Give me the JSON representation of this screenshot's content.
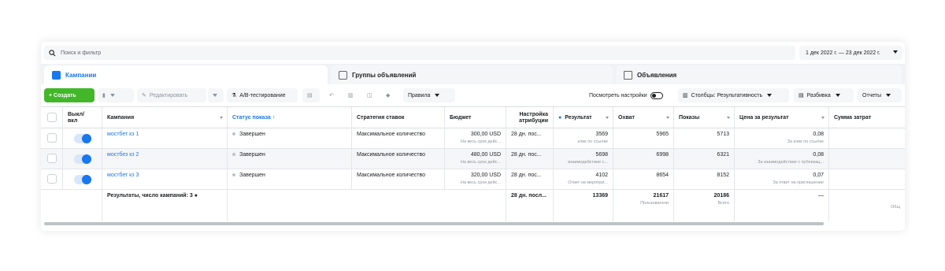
{
  "search": {
    "placeholder": "Поиск и фильтр"
  },
  "date_range": "1 дек 2022 г. — 23 дек 2022 г.",
  "tabs": [
    {
      "label": "Кампании"
    },
    {
      "label": "Группы объявлений"
    },
    {
      "label": "Объявления"
    }
  ],
  "toolbar": {
    "create": "+ Создать",
    "edit": "Редактировать",
    "ab_test": "A/B-тестирование",
    "rules": "Правила",
    "view_settings": "Посмотреть настройки",
    "columns": "Столбцы: Результативность",
    "breakdown": "Разбивка",
    "reports": "Отчеты"
  },
  "columns": {
    "onoff": "Выкл/ вкл",
    "campaign": "Кампания",
    "status": "Статус показа ↑",
    "bid": "Стратегия ставок",
    "budget": "Бюджет",
    "attribution": "Настройка атрибуции",
    "result": "Результат",
    "reach": "Охват",
    "impressions": "Показы",
    "cost_per_result": "Цена за результат",
    "spend": "Сумма затрат"
  },
  "rows": [
    {
      "name": "мостбет кз 1",
      "status": "Завершен",
      "bid": "Максимальное количество",
      "budget": "300,00 USD",
      "budget_sub": "На весь срок дейс...",
      "attribution": "28 дн. пос...",
      "result": "3569",
      "result_sub": "клик по ссылке",
      "reach": "5965",
      "impressions": "5713",
      "cost": "0,08",
      "cost_sub": "За клик по ссылке"
    },
    {
      "name": "мостбез кз 2",
      "status": "Завершен",
      "bid": "Максимальное количество",
      "budget": "480,00 USD",
      "budget_sub": "На весь срок дейс...",
      "attribution": "28 дн. пос...",
      "result": "5698",
      "result_sub": "взаимодействие с...",
      "reach": "6998",
      "impressions": "6321",
      "cost": "0,08",
      "cost_sub": "За взаимодействие с публикац..."
    },
    {
      "name": "мостбет кз 3",
      "status": "Завершен",
      "bid": "Максимальное количество",
      "budget": "320,00 USD",
      "budget_sub": "На весь срок дейс...",
      "attribution": "28 дн. пос...",
      "result": "4102",
      "result_sub": "Ответ на меропри...",
      "reach": "8654",
      "impressions": "8152",
      "cost": "0,07",
      "cost_sub": "За ответ на приглашение"
    }
  ],
  "totals": {
    "label": "Результаты, число кампаний: 3",
    "attribution": "28 дн. посл...",
    "result": "13369",
    "reach": "21617",
    "reach_sub": "Пользователи",
    "impressions": "20186",
    "impressions_sub": "Всего",
    "cost": "—",
    "spend_sub": "Общ"
  },
  "colors": {
    "accent": "#1877f2",
    "create": "#42b72a"
  }
}
